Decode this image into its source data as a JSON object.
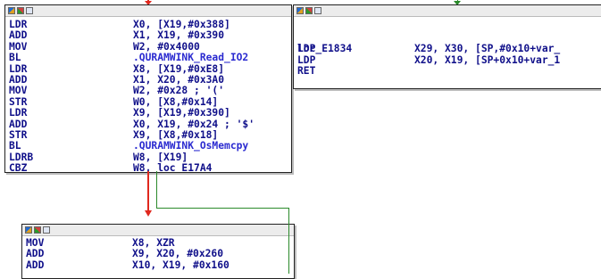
{
  "colors": {
    "mnemonic": "#10108a",
    "function_name": "#2a2ad0",
    "comment": "#8c8c8c",
    "true_edge": "#2a8a2a",
    "false_edge": "#e0281e"
  },
  "block_a": {
    "title_icons": [
      "graph-icon",
      "image-icon",
      "text-icon"
    ],
    "lines": [
      {
        "mn": "LDR",
        "ops": "X0, [X19,#0x388]"
      },
      {
        "mn": "ADD",
        "ops": "X1, X19, #0x390"
      },
      {
        "mn": "MOV",
        "ops": "W2, #0x4000"
      },
      {
        "mn": "BL",
        "ops": ".QURAMWINK_Read_IO2"
      },
      {
        "mn": "LDR",
        "ops": "X8, [X19,#0xE8]"
      },
      {
        "mn": "ADD",
        "ops": "X1, X20, #0x3A0"
      },
      {
        "mn": "MOV",
        "ops": "W2, #0x28 ; '('"
      },
      {
        "mn": "STR",
        "ops": "W0, [X8,#0x14]"
      },
      {
        "mn": "LDR",
        "ops": "X9, [X19,#0x390]"
      },
      {
        "mn": "ADD",
        "ops": "X0, X19, #0x24 ; '$'"
      },
      {
        "mn": "STR",
        "ops": "X9, [X8,#0x18]"
      },
      {
        "mn": "BL",
        "ops": ".QURAMWINK_OsMemcpy"
      },
      {
        "mn": "LDRB",
        "ops": "W8, [X19]"
      },
      {
        "mn": "CBZ",
        "ops": "W8, loc_E17A4"
      }
    ]
  },
  "block_b": {
    "title_icons": [
      "graph-icon",
      "image-icon",
      "text-icon"
    ],
    "label": "loc_E1834",
    "lines": [
      {
        "mn": "LDP",
        "ops": "X29, X30, [SP,#0x10+var_"
      },
      {
        "mn": "LDP",
        "ops": "X20, X19, [SP+0x10+var_1"
      },
      {
        "mn": "RET",
        "ops": ""
      }
    ]
  },
  "block_c": {
    "title_icons": [
      "graph-icon",
      "image-icon",
      "text-icon"
    ],
    "lines": [
      {
        "mn": "MOV",
        "ops": "X8, XZR"
      },
      {
        "mn": "ADD",
        "ops": "X9, X20, #0x260"
      },
      {
        "mn": "ADD",
        "ops": "X10, X19, #0x160"
      }
    ]
  }
}
